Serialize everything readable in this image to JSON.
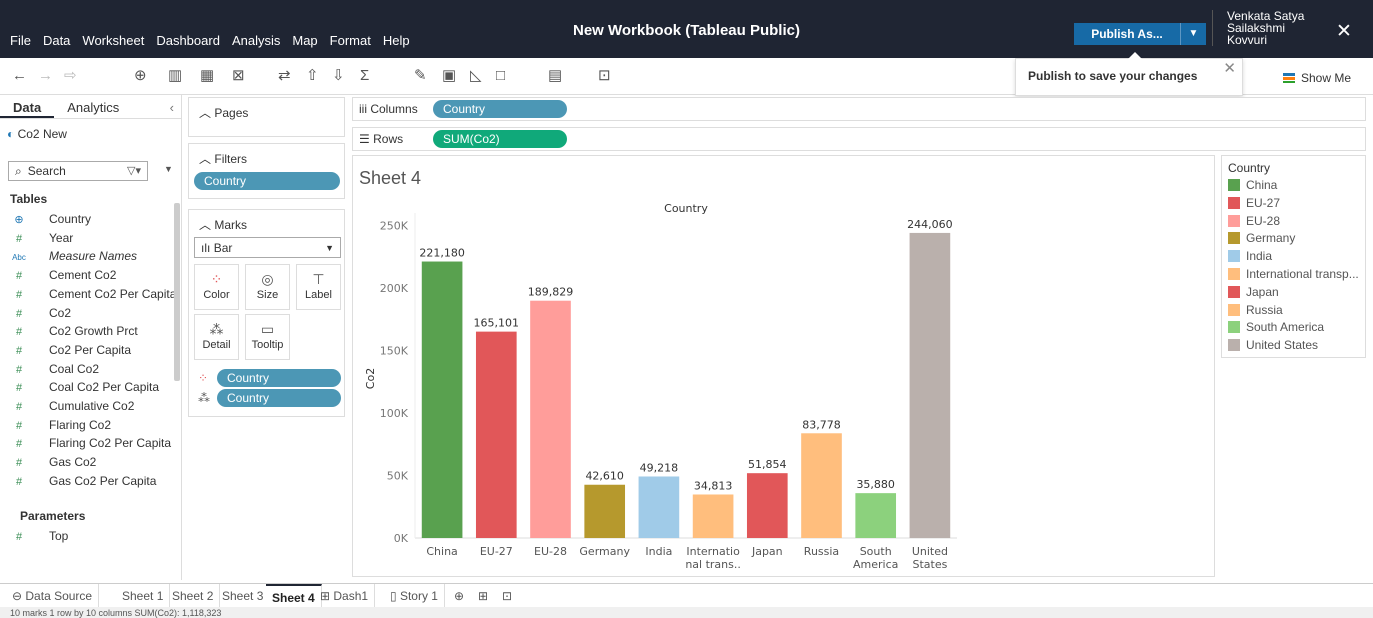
{
  "app": {
    "title": "New Workbook (Tableau Public)",
    "menu": [
      "File",
      "Data",
      "Worksheet",
      "Dashboard",
      "Analysis",
      "Map",
      "Format",
      "Help"
    ],
    "publish_label": "Publish As...",
    "user_name": "Venkata Satya Sailakshmi Kovvuri",
    "publish_tip": "Publish to save your changes",
    "show_me": "Show Me"
  },
  "data_pane": {
    "tabs": [
      "Data",
      "Analytics"
    ],
    "datasource": "Co2 New",
    "search_placeholder": "Search",
    "tables_header": "Tables",
    "fields": [
      {
        "name": "Country",
        "type": "geo"
      },
      {
        "name": "Year",
        "type": "measure"
      },
      {
        "name": "Measure Names",
        "type": "abc"
      },
      {
        "name": "Cement Co2",
        "type": "measure"
      },
      {
        "name": "Cement Co2 Per Capita",
        "type": "measure"
      },
      {
        "name": "Co2",
        "type": "measure"
      },
      {
        "name": "Co2 Growth Prct",
        "type": "measure"
      },
      {
        "name": "Co2 Per Capita",
        "type": "measure"
      },
      {
        "name": "Coal Co2",
        "type": "measure"
      },
      {
        "name": "Coal Co2 Per Capita",
        "type": "measure"
      },
      {
        "name": "Cumulative Co2",
        "type": "measure"
      },
      {
        "name": "Flaring Co2",
        "type": "measure"
      },
      {
        "name": "Flaring Co2 Per Capita",
        "type": "measure"
      },
      {
        "name": "Gas Co2",
        "type": "measure"
      },
      {
        "name": "Gas Co2 Per Capita",
        "type": "measure"
      }
    ],
    "parameters_header": "Parameters",
    "parameters": [
      {
        "name": "Top"
      }
    ]
  },
  "cards": {
    "pages": "Pages",
    "filters": "Filters",
    "filter_pill": "Country",
    "marks": "Marks",
    "mark_type": "Bar",
    "mark_buttons": [
      "Color",
      "Size",
      "Label",
      "Detail",
      "Tooltip"
    ],
    "color_pill": "Country",
    "detail_pill": "Country"
  },
  "shelves": {
    "columns_label": "Columns",
    "columns_pill": "Country",
    "rows_label": "Rows",
    "rows_pill": "SUM(Co2)"
  },
  "sheet_title": "Sheet 4",
  "chart_data": {
    "type": "bar",
    "title": "",
    "header": "Country",
    "ylabel": "Co2",
    "ylim": [
      0,
      260000
    ],
    "yticks": [
      0,
      50000,
      100000,
      150000,
      200000,
      250000
    ],
    "ytick_labels": [
      "0K",
      "50K",
      "100K",
      "150K",
      "200K",
      "250K"
    ],
    "categories": [
      "China",
      "EU-27",
      "EU-28",
      "Germany",
      "India",
      "International trans..",
      "Japan",
      "Russia",
      "South America",
      "United States"
    ],
    "category_labels": [
      [
        "China"
      ],
      [
        "EU-27"
      ],
      [
        "EU-28"
      ],
      [
        "Germany"
      ],
      [
        "India"
      ],
      [
        "Internatio",
        "nal trans.."
      ],
      [
        "Japan"
      ],
      [
        "Russia"
      ],
      [
        "South",
        "America"
      ],
      [
        "United",
        "States"
      ]
    ],
    "values": [
      221180,
      165101,
      189829,
      42610,
      49218,
      34813,
      51854,
      83778,
      35880,
      244060
    ],
    "value_labels": [
      "221,180",
      "165,101",
      "189,829",
      "42,610",
      "49,218",
      "34,813",
      "51,854",
      "83,778",
      "35,880",
      "244,060"
    ],
    "colors": [
      "#59a14f",
      "#e15759",
      "#ff9d9a",
      "#b6992d",
      "#a0cbe8",
      "#ffbe7d",
      "#e15759",
      "#ffbe7d",
      "#8cd17d",
      "#bab0ac"
    ]
  },
  "legend": {
    "title": "Country",
    "items": [
      {
        "name": "China",
        "color": "#59a14f"
      },
      {
        "name": "EU-27",
        "color": "#e15759"
      },
      {
        "name": "EU-28",
        "color": "#ff9d9a"
      },
      {
        "name": "Germany",
        "color": "#b6992d"
      },
      {
        "name": "India",
        "color": "#a0cbe8"
      },
      {
        "name": "International transp...",
        "color": "#ffbe7d"
      },
      {
        "name": "Japan",
        "color": "#e15759"
      },
      {
        "name": "Russia",
        "color": "#ffbe7d"
      },
      {
        "name": "South America",
        "color": "#8cd17d"
      },
      {
        "name": "United States",
        "color": "#bab0ac"
      }
    ]
  },
  "sheet_tabs": [
    "Data Source",
    "Sheet 1",
    "Sheet 2",
    "Sheet 3",
    "Sheet 4",
    "Dash1",
    "Story 1"
  ],
  "status": "10 marks   1 row by 10 columns   SUM(Co2): 1,118,323"
}
